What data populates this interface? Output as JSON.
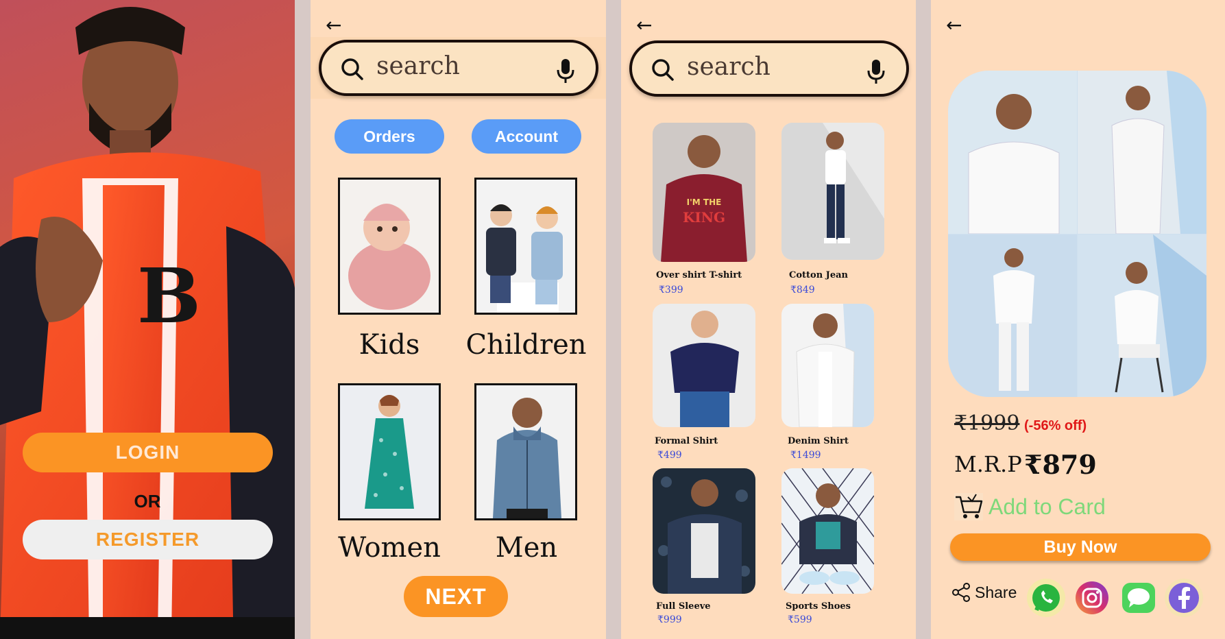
{
  "login_screen": {
    "login_label": "LOGIN",
    "or_label": "OR",
    "register_label": "REGISTER"
  },
  "category_screen": {
    "search_placeholder": "search",
    "chips": [
      "Orders",
      "Account"
    ],
    "categories": [
      "Kids",
      "Children",
      "Women",
      "Men"
    ],
    "next_label": "NEXT"
  },
  "product_screen": {
    "search_placeholder": "search",
    "products": [
      {
        "name": "Over shirt  T-shirt",
        "price": "₹399"
      },
      {
        "name": "Cotton Jean",
        "price": "₹849"
      },
      {
        "name": "Formal Shirt",
        "price": "₹499"
      },
      {
        "name": "Denim Shirt",
        "price": "₹1499"
      },
      {
        "name": "Full Sleeve",
        "price": "₹999"
      },
      {
        "name": "Sports Shoes",
        "price": "₹599"
      }
    ]
  },
  "detail_screen": {
    "old_price": "₹1999",
    "discount": "(-56% off)",
    "mrp_label": "M.R.P",
    "mrp_value": "₹879",
    "add_to_cart": "Add to Card",
    "buy_now": "Buy Now",
    "share_label": "Share",
    "social_icons": [
      "whatsapp-icon",
      "instagram-icon",
      "message-icon",
      "facebook-icon"
    ]
  },
  "colors": {
    "peach": "#fedcbd",
    "orange": "#fb9424",
    "blue_chip": "#5a9cf7",
    "discount_red": "#e01818",
    "cart_green": "#7ed87a",
    "price_blue": "#3a4ad8"
  }
}
